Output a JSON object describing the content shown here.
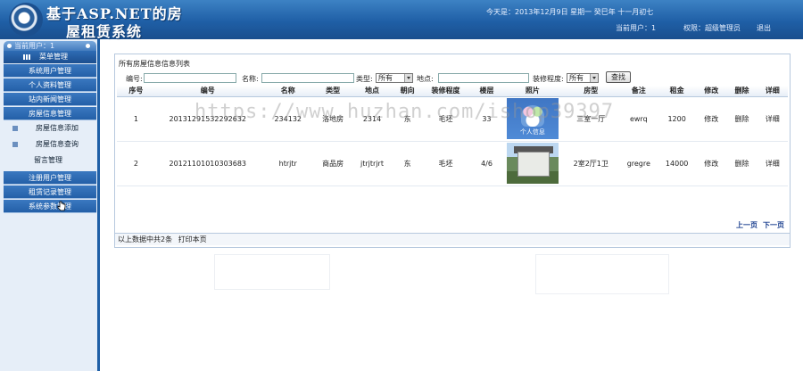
{
  "header": {
    "title_line1": "基于ASP.NET的房",
    "title_line2": "屋租赁系统",
    "today": "今天是：2013年12月9日 星期一 癸巳年 十一月初七",
    "current_user": "当前用户：1",
    "role": "权限：超级管理员",
    "logout": "退出"
  },
  "sidebar": {
    "current_user_label": "当前用户：1",
    "menu_title": "菜单管理",
    "items": [
      {
        "label": "系统用户管理"
      },
      {
        "label": "个人资料管理"
      },
      {
        "label": "站内新闻管理"
      },
      {
        "label": "房屋信息管理"
      },
      {
        "label": "房屋信息添加",
        "sub": true
      },
      {
        "label": "房屋信息查询",
        "sub": true
      },
      {
        "label": "留言管理"
      },
      {
        "label": "注册用户管理"
      },
      {
        "label": "租赁记录管理"
      },
      {
        "label": "系统参数管理"
      }
    ]
  },
  "main": {
    "title": "所有房屋信息信息列表",
    "search": {
      "number_label": "编号:",
      "name_label": "名称:",
      "type_label": "类型:",
      "type_value": "所有",
      "location_label": "地点:",
      "decoration_label": "装修程度:",
      "decoration_value": "所有",
      "search_button": "查找"
    },
    "columns": [
      "序号",
      "编号",
      "名称",
      "类型",
      "地点",
      "朝向",
      "装修程度",
      "楼层",
      "照片",
      "房型",
      "备注",
      "租金",
      "修改",
      "删除",
      "详细"
    ],
    "rows": [
      {
        "index": "1",
        "number": "20131291532292632",
        "name": "234132",
        "type": "洛地房",
        "location": "2314",
        "orientation": "东",
        "decoration": "毛坯",
        "floor": "33",
        "photo_caption": "个人信息",
        "layout": "三室一厅",
        "remark": "ewrq",
        "rent": "1200",
        "edit": "修改",
        "delete": "删除",
        "detail": "详细"
      },
      {
        "index": "2",
        "number": "20121101010303683",
        "name": "htrjtr",
        "type": "商品房",
        "location": "jtrjtrjrt",
        "orientation": "东",
        "decoration": "毛坯",
        "floor": "4/6",
        "photo_caption": "",
        "layout": "2室2厅1卫",
        "remark": "gregre",
        "rent": "14000",
        "edit": "修改",
        "delete": "删除",
        "detail": "详细"
      }
    ],
    "pager_prev": "上一页",
    "pager_next": "下一页",
    "footer_text": "以上数据中共2条",
    "print_link": "打印本页"
  },
  "watermark": "https://www.huzhan.com/ishop39397",
  "colors": {
    "header_blue": "#1f5fa6",
    "menu_blue": "#2e6cb5",
    "sidebar_bg": "#e6eef8",
    "link_blue": "#1a3f8f"
  }
}
